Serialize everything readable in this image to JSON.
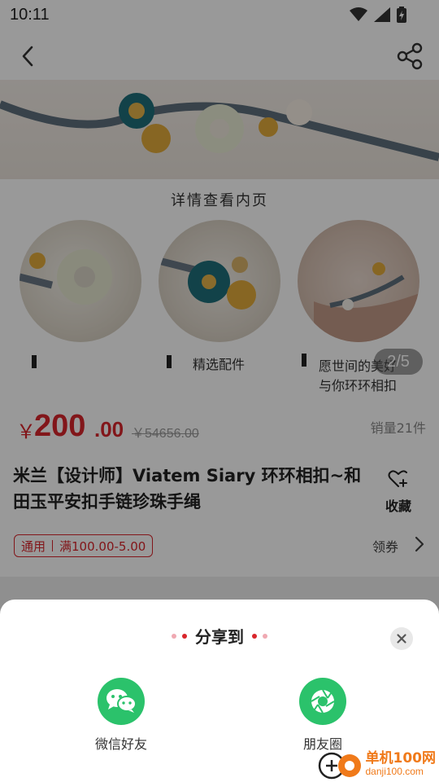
{
  "status_bar": {
    "time": "10:11"
  },
  "product": {
    "detail_caption": "详情查看内页",
    "thumb_labels": [
      "精选配件",
      "愿世间的美好",
      "与你环环相扣"
    ],
    "image_counter": "2/5",
    "price_symbol": "￥",
    "price_int": "200",
    "price_dec": ".00",
    "original_price": "￥54656.00",
    "sales": "销量21件",
    "title": "米兰【设计师】Viatem Siary 环环相扣~和田玉平安扣手链珍珠手绳",
    "favorite_label": "收藏",
    "coupon": {
      "tag": "通用",
      "text": "满100.00-5.00"
    },
    "get_coupon_label": "领券"
  },
  "share_sheet": {
    "title": "分享到",
    "options": [
      {
        "label": "微信好友",
        "icon": "wechat-icon"
      },
      {
        "label": "朋友圈",
        "icon": "moments-icon"
      }
    ]
  },
  "watermark": {
    "top": "单机100网",
    "bottom": "danji100.com"
  },
  "colors": {
    "accent": "#d9262c",
    "share_green": "#2bc26b",
    "overlay": "rgba(0,0,0,0.40)"
  }
}
